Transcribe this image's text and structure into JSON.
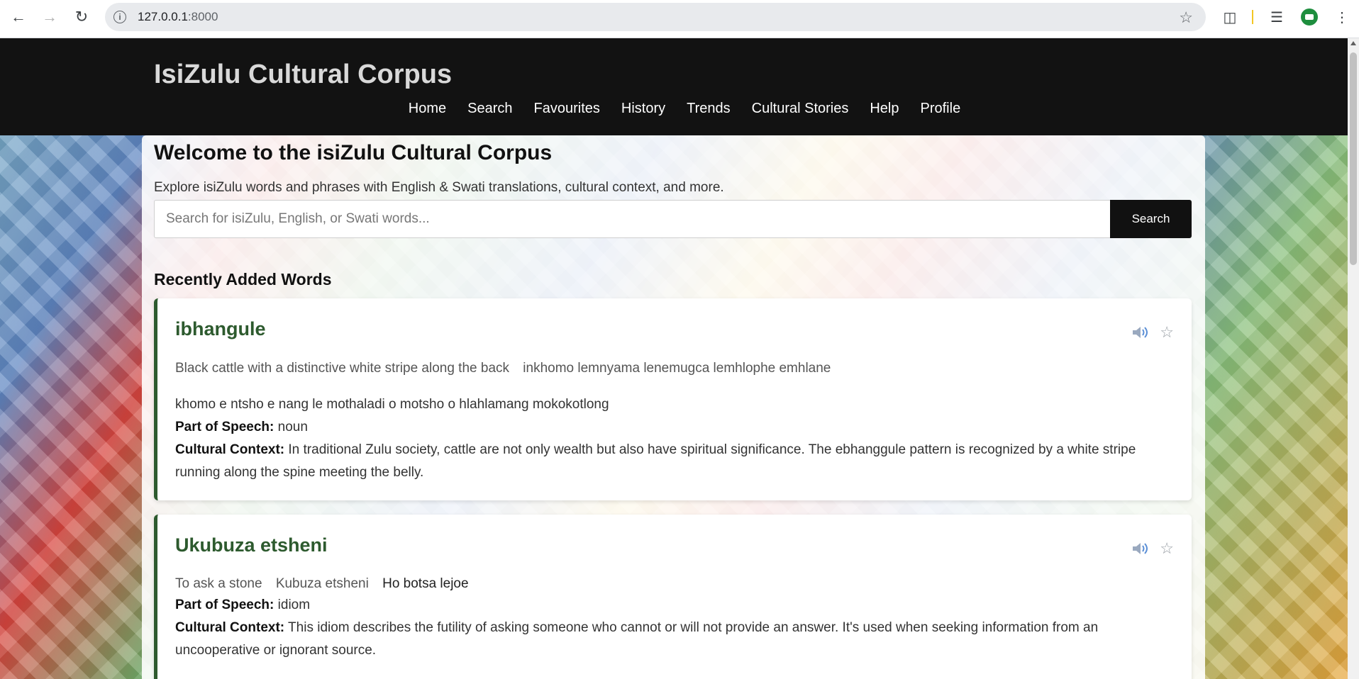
{
  "browser": {
    "url_host": "127.0.0.1",
    "url_port": ":8000"
  },
  "site": {
    "title": "IsiZulu Cultural Corpus",
    "nav": [
      "Home",
      "Search",
      "Favourites",
      "History",
      "Trends",
      "Cultural Stories",
      "Help",
      "Profile"
    ]
  },
  "main": {
    "welcome": "Welcome to the isiZulu Cultural Corpus",
    "intro": "Explore isiZulu words and phrases with English & Swati translations, cultural context, and more.",
    "search_placeholder": "Search for isiZulu, English, or Swati words...",
    "search_button": "Search",
    "recent_heading": "Recently Added Words"
  },
  "labels": {
    "pos": "Part of Speech:",
    "context": "Cultural Context:"
  },
  "words": [
    {
      "word": "ibhangule",
      "english": "Black cattle with a distinctive white stripe along the back",
      "swati": "inkhomo lemnyama lenemugca lemhlophe emhlane",
      "sotho": "khomo e ntsho e nang le mothaladi o motsho o hlahlamang mokokotlong",
      "pos": "noun",
      "context": "In traditional Zulu society, cattle are not only wealth but also have spiritual significance. The ebhanggule pattern is recognized by a white stripe running along the spine meeting the belly."
    },
    {
      "word": "Ukubuza etsheni",
      "english": "To ask a stone",
      "swati": "Kubuza etsheni",
      "sotho": "Ho botsa lejoe",
      "pos": "idiom",
      "context": "This idiom describes the futility of asking someone who cannot or will not provide an answer. It's used when seeking information from an uncooperative or ignorant source."
    }
  ],
  "colors": {
    "header_bg": "#121212",
    "word_green": "#2d5a2e",
    "search_button_bg": "#111111"
  }
}
